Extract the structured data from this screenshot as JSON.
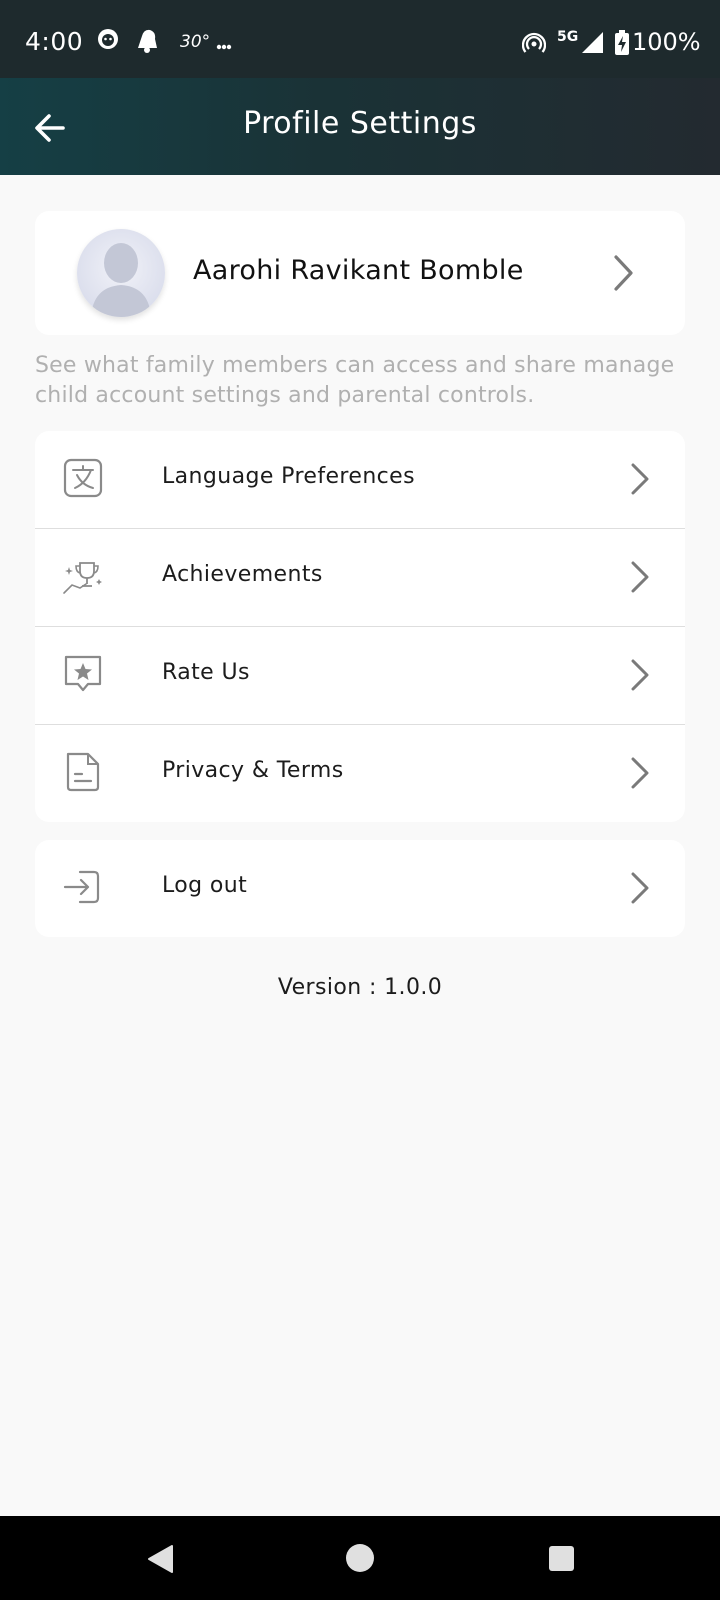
{
  "status_bar": {
    "time": "4:00",
    "temperature": "30°",
    "network": "5G",
    "battery": "100%"
  },
  "header": {
    "title": "Profile Settings"
  },
  "profile": {
    "name": "Aarohi Ravikant Bomble"
  },
  "subtitle": "See what family members can access and share manage child account settings  and parental controls.",
  "menu": {
    "items": [
      {
        "label": "Language Preferences",
        "icon": "language-icon"
      },
      {
        "label": "Achievements",
        "icon": "trophy-icon"
      },
      {
        "label": "Rate Us",
        "icon": "star-review-icon"
      },
      {
        "label": "Privacy & Terms",
        "icon": "document-icon"
      }
    ]
  },
  "logout": {
    "label": "Log out",
    "icon": "logout-icon"
  },
  "version": "Version : 1.0.0",
  "colors": {
    "header_start": "#153f45",
    "header_end": "#232a30",
    "background": "#f9f9f9",
    "subtitle": "#b0b0b0"
  }
}
